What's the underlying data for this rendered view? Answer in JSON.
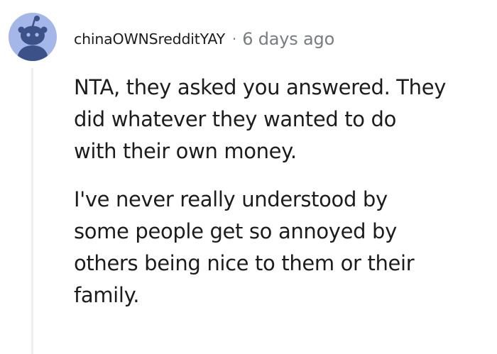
{
  "comment": {
    "username": "chinaOWNSredditYAY",
    "separator": "·",
    "timestamp": "6 days ago",
    "paragraphs": [
      [
        "NTA, they asked you answered. They",
        "did whatever they wanted to do",
        "with their own money."
      ],
      [
        "I've never really understood by",
        "some people get so annoyed by",
        "others being nice to them or their",
        "family."
      ]
    ]
  },
  "colors": {
    "avatar_background": "#a5b6e8",
    "avatar_figure": "#3c5188",
    "text": "#1c1c1c",
    "meta_text": "#787c7e",
    "thread_line": "#edeff1"
  },
  "icons": {
    "avatar": "snoo-avatar-icon"
  }
}
